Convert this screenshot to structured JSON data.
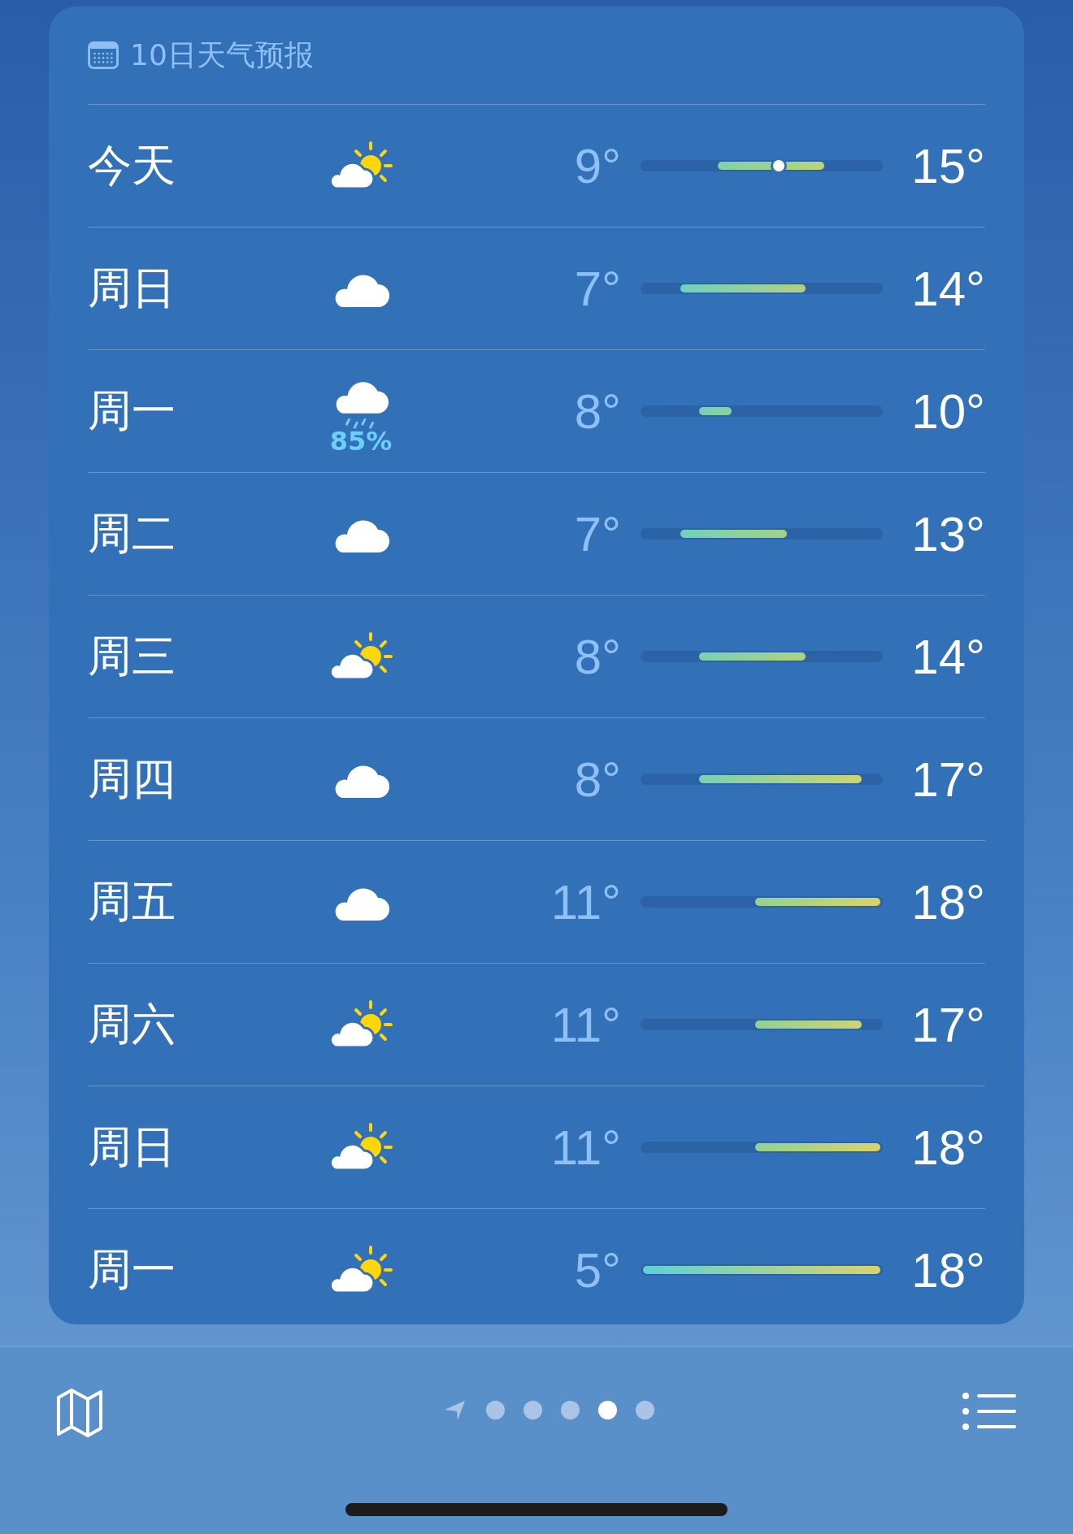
{
  "forecast": {
    "title": "10日天气预报",
    "days": [
      {
        "day": "今天",
        "kind": "partly_sunny",
        "low": "9°",
        "high": "15°",
        "level": 0.57
      },
      {
        "day": "周日",
        "kind": "cloudy",
        "low": "7°",
        "high": "14°"
      },
      {
        "day": "周一",
        "kind": "rain",
        "precipitation": "85%",
        "low": "8°",
        "high": "10°"
      },
      {
        "day": "周二",
        "kind": "cloudy",
        "low": "7°",
        "high": "13°"
      },
      {
        "day": "周三",
        "kind": "partly_sunny",
        "low": "8°",
        "high": "14°"
      },
      {
        "day": "周四",
        "kind": "cloudy",
        "low": "8°",
        "high": "17°"
      },
      {
        "day": "周五",
        "kind": "cloudy",
        "low": "11°",
        "high": "18°"
      },
      {
        "day": "周六",
        "kind": "partly_sunny",
        "low": "11°",
        "high": "17°"
      },
      {
        "day": "周日",
        "kind": "partly_sunny",
        "low": "11°",
        "high": "18°"
      },
      {
        "day": "周一",
        "kind": "partly_sunny",
        "low": "5°",
        "high": "18°"
      }
    ]
  },
  "pages": [
    {
      "kind": "location",
      "selected": false
    },
    {
      "kind": "dot",
      "selected": false
    },
    {
      "kind": "dot",
      "selected": false
    },
    {
      "kind": "dot",
      "selected": false
    },
    {
      "kind": "dot",
      "selected": true
    },
    {
      "kind": "dot",
      "selected": false
    }
  ]
}
